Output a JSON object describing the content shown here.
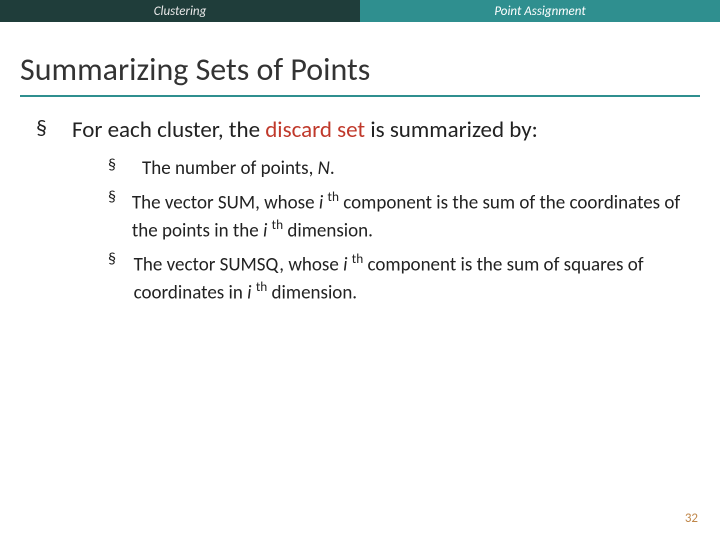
{
  "tabs": {
    "left": "Clustering",
    "right": "Point Assignment"
  },
  "title": "Summarizing Sets of Points",
  "intro": {
    "pre": "For each cluster, the ",
    "hl": "discard set",
    "post": " is summarized by:"
  },
  "sub": [
    {
      "a": "The number of points, ",
      "b": "N",
      "c": "."
    },
    {
      "a": "The vector SUM, whose ",
      "b": "i ",
      "c": "th",
      "d": " component is the sum of the coordinates of the points in the ",
      "e": "i ",
      "f": "th",
      "g": " dimension."
    },
    {
      "a": "The vector SUMSQ, whose ",
      "b": "i ",
      "c": "th",
      "d": " component is the sum of squares of coordinates in ",
      "e": "i ",
      "f": "th",
      "g": " dimension."
    }
  ],
  "page": "32",
  "bullet": "§"
}
